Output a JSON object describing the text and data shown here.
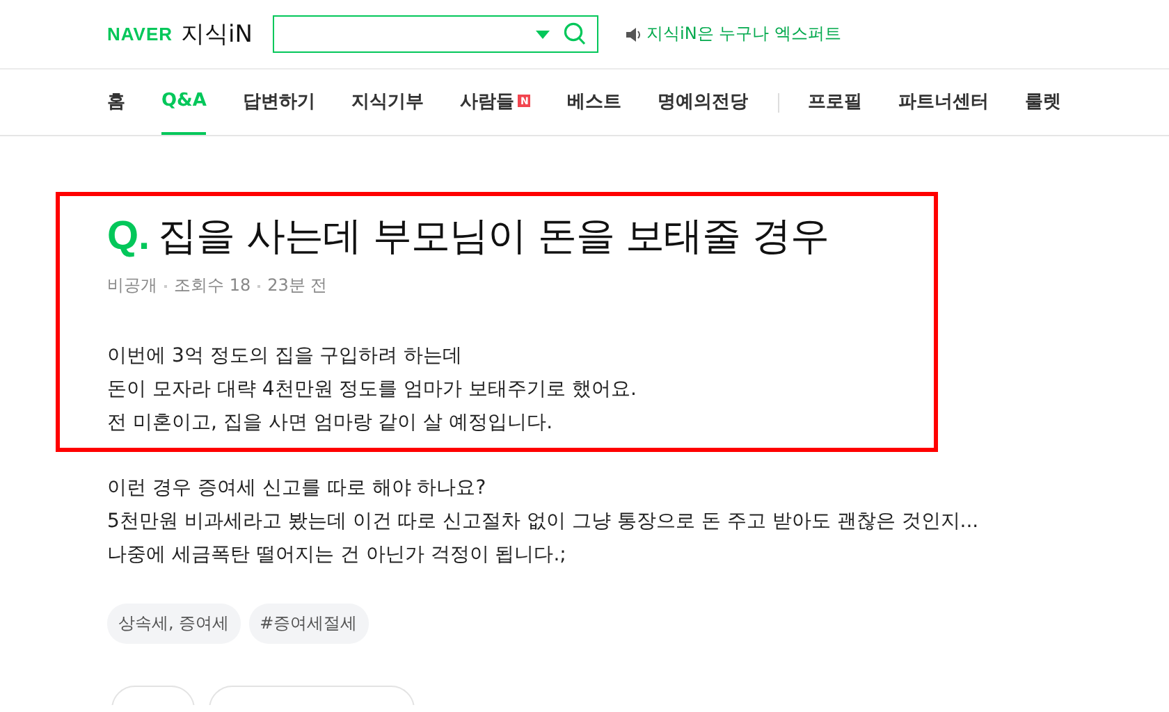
{
  "header": {
    "brand": "NAVER",
    "service": "지식iN",
    "notice": "지식iN은 누구나 엑스퍼트"
  },
  "nav": {
    "items": [
      {
        "label": "홈",
        "selected": false,
        "divider_before": false
      },
      {
        "label": "Q&A",
        "selected": true,
        "divider_before": false
      },
      {
        "label": "답변하기",
        "selected": false,
        "divider_before": false
      },
      {
        "label": "지식기부",
        "selected": false,
        "divider_before": false
      },
      {
        "label": "사람들",
        "selected": false,
        "badge": "N",
        "divider_before": false
      },
      {
        "label": "베스트",
        "selected": false,
        "divider_before": false
      },
      {
        "label": "명예의전당",
        "selected": false,
        "divider_before": false
      },
      {
        "label": "프로필",
        "selected": false,
        "divider_before": true
      },
      {
        "label": "파트너센터",
        "selected": false,
        "divider_before": false
      },
      {
        "label": "룰렛",
        "selected": false,
        "divider_before": false
      }
    ]
  },
  "question": {
    "mark": "Q.",
    "title": "집을 사는데 부모님이 돈을 보태줄 경우",
    "meta": [
      "비공개",
      "조회수 18",
      "23분 전"
    ],
    "highlighted_lines": [
      "이번에 3억 정도의 집을 구입하려 하는데",
      "돈이 모자라 대략 4천만원 정도를 엄마가 보태주기로 했어요.",
      "전 미혼이고, 집을 사면 엄마랑 같이 살 예정입니다."
    ],
    "lines": [
      "이런 경우 증여세 신고를 따로 해야 하나요?",
      "5천만원 비과세라고 봤는데 이건 따로 신고절차 없이 그냥 통장으로 돈 주고 받아도 괜찮은 것인지...",
      "나중에 세금폭탄 떨어지는 건 아닌가 걱정이 됩니다.;"
    ],
    "tags": [
      "상속세, 증여세",
      "#증여세절세"
    ]
  }
}
